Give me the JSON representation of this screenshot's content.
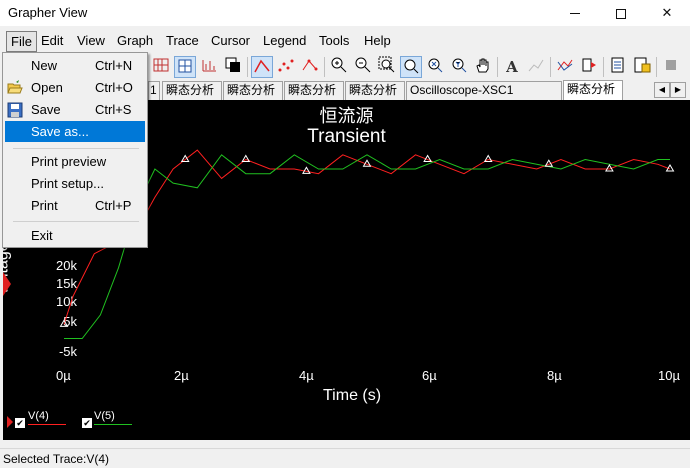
{
  "window": {
    "title": "Grapher View",
    "controls": {
      "minimize": "minimize-icon",
      "maximize": "maximize-icon",
      "close": "✕"
    }
  },
  "menubar": [
    "File",
    "Edit",
    "View",
    "Graph",
    "Trace",
    "Cursor",
    "Legend",
    "Tools",
    "Help"
  ],
  "file_menu": {
    "items": [
      {
        "label": "New",
        "shortcut": "Ctrl+N",
        "icon": ""
      },
      {
        "label": "Open",
        "shortcut": "Ctrl+O",
        "icon": "open-folder-icon"
      },
      {
        "label": "Save",
        "shortcut": "Ctrl+S",
        "icon": "save-disk-icon"
      },
      {
        "label": "Save as...",
        "shortcut": "",
        "icon": ""
      },
      {
        "label": "Print preview",
        "shortcut": "",
        "icon": ""
      },
      {
        "label": "Print setup...",
        "shortcut": "",
        "icon": ""
      },
      {
        "label": "Print",
        "shortcut": "Ctrl+P",
        "icon": ""
      },
      {
        "label": "Exit",
        "shortcut": "",
        "icon": ""
      }
    ],
    "highlighted": "Save as..."
  },
  "tabs": [
    "1",
    "瞬态分析",
    "瞬态分析",
    "瞬态分析",
    "瞬态分析",
    "Oscilloscope-XSC1",
    "瞬态分析"
  ],
  "selected_tab_index": 6,
  "plot": {
    "title_cn": "恒流源",
    "title_en": "Transient",
    "y_axis_label": "Voltage",
    "x_axis_label": "Time (s)",
    "y_ticks": [
      "20k",
      "15k",
      "10k",
      "5k",
      "-5k"
    ],
    "x_ticks": [
      "0µ",
      "2µ",
      "4µ",
      "6µ",
      "8µ",
      "10µ"
    ],
    "background": "#000000"
  },
  "legend": [
    {
      "name": "V(4)",
      "color": "#ff2020"
    },
    {
      "name": "V(5)",
      "color": "#20c020"
    }
  ],
  "chart_data": {
    "type": "line",
    "title": "Transient",
    "xlabel": "Time (s)",
    "ylabel": "Voltage",
    "xlim": [
      0,
      10
    ],
    "ylim": [
      -8,
      40
    ],
    "series": [
      {
        "name": "V(4)",
        "x": [
          0,
          0.15,
          0.5,
          0.8,
          1.0,
          1.2,
          1.5,
          1.8,
          2.2,
          2.6,
          3.0,
          3.4,
          3.8,
          4.2,
          4.6,
          5.0,
          5.4,
          5.8,
          6.2,
          6.6,
          7.0,
          7.4,
          7.8,
          8.2,
          8.6,
          9.0,
          9.4,
          9.8,
          10.0
        ],
        "y": [
          0,
          6,
          15,
          17,
          19,
          20,
          27,
          33,
          37,
          31,
          35,
          33,
          33,
          32,
          36,
          34,
          32,
          36,
          34,
          32,
          35,
          34,
          33,
          35,
          33,
          33,
          35,
          34,
          33
        ]
      },
      {
        "name": "V(5)",
        "x": [
          0,
          0.3,
          0.6,
          0.9,
          1.2,
          1.5,
          1.8,
          2.2,
          2.6,
          3.0,
          3.4,
          3.8,
          4.2,
          4.6,
          5.0,
          5.4,
          5.8,
          6.2,
          6.6,
          7.0,
          7.4,
          7.8,
          8.2,
          8.6,
          9.0,
          9.4,
          9.8,
          10.0
        ],
        "y": [
          -3,
          -3,
          2,
          12,
          25,
          33,
          30,
          29,
          36,
          32,
          32,
          36,
          33,
          33,
          36,
          33,
          33,
          35,
          33,
          33,
          35,
          34,
          33,
          35,
          34,
          33,
          35,
          35
        ]
      }
    ],
    "grid": false,
    "legend": "bottom-left"
  },
  "status": {
    "text": "Selected Trace:V(4)"
  }
}
